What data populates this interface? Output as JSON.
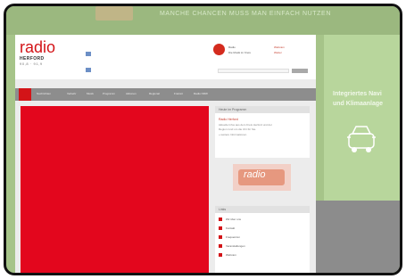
{
  "banner": {
    "text": "MANCHE CHANCEN MUSS MAN EINFACH NUTZEN",
    "color": "#9bb87f"
  },
  "side_ad": {
    "line1": "Integriertes Navi",
    "line2": "und Klimaanlage",
    "color": "#b8d69c"
  },
  "logo": {
    "wordmark": "radio",
    "sub": "HERFORD",
    "freq": "90,8 · 91,9",
    "brand_color": "#d31418"
  },
  "header": {
    "player_title": "Radio",
    "player_sub": "Die Musik im Kreis",
    "link1": "Webcam",
    "link2": "Wetter"
  },
  "nav": {
    "items": [
      "Nachrichten",
      "Verkehr",
      "Musik",
      "Programm",
      "Aktionen",
      "Regional",
      "Freizeit",
      "Radio NRW"
    ]
  },
  "sidebar": {
    "widget1_head": "Heute im Programm",
    "widget1_title": "Radio Herford",
    "widget1_lines": [
      "Aktuelle Infos aus dem Kreis Herford und der",
      "Region rund um die Uhr für Sie.",
      "» weitere Informationen"
    ],
    "promo_text": "radio",
    "widget2_head": "Links",
    "links": [
      "Wir über uns",
      "Kontakt",
      "Frequenzen",
      "Veranstaltungen",
      "Webcam"
    ]
  }
}
